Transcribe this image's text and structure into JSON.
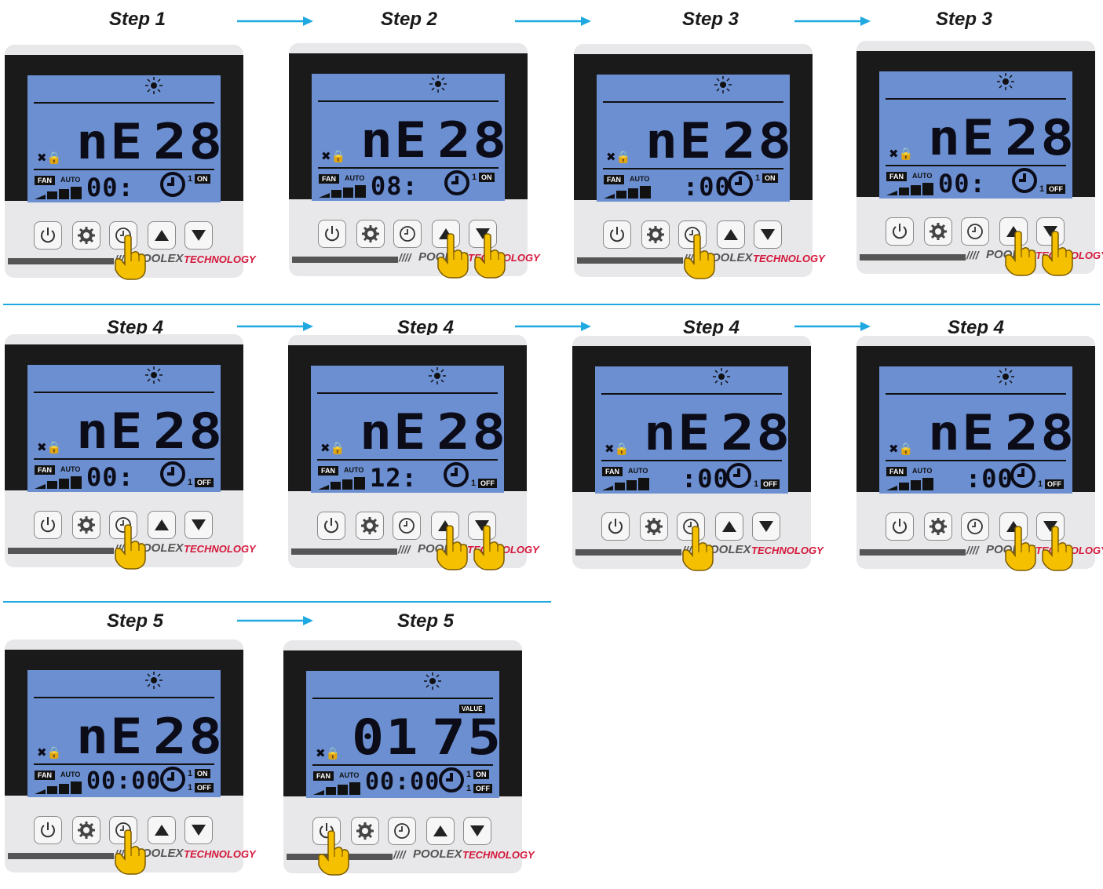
{
  "steps": {
    "row1": [
      "Step 1",
      "Step 2",
      "Step 3",
      "Step 3"
    ],
    "row2": [
      "Step 4",
      "Step 4",
      "Step 4",
      "Step 4"
    ],
    "row3": [
      "Step 5",
      "Step 5"
    ]
  },
  "display": {
    "mode_text": "nE",
    "temp_text": "28",
    "fan_label": "FAN",
    "auto_label": "AUTO",
    "on_label": "ON",
    "off_label": "OFF",
    "timer_num": "1",
    "value_label": "VALUE",
    "big_left_final": "01",
    "big_right_final": "75"
  },
  "timer_digits": {
    "p1": "00:",
    "p2": "08:",
    "p3": ":00",
    "p4": "00:",
    "p5": "00:",
    "p6": "12:",
    "p7": ":00",
    "p8": ":00",
    "p9": "00:00",
    "p10": "00:00"
  },
  "brand": {
    "slashes": "////",
    "name": "POOLEX",
    "tech": "TECHNOLOGY"
  },
  "icons": {
    "buttons": [
      "power-icon",
      "gear-icon",
      "clock-icon",
      "up-arrow-icon",
      "down-arrow-icon"
    ],
    "hand": "pointing-hand-icon",
    "sun": "sun-icon"
  },
  "colors": {
    "lcd": "#6b8fd1",
    "bezel": "#1a1a1a",
    "panel": "#e8e8ea",
    "arrow": "#1fa9e0",
    "tech": "#d4173a",
    "hand": "#f5c000"
  }
}
